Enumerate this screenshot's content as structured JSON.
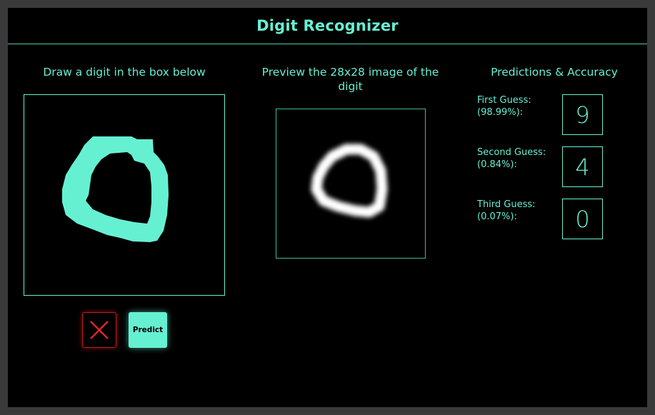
{
  "app": {
    "title": "Digit Recognizer"
  },
  "draw_panel": {
    "heading": "Draw a digit in the box below",
    "clear_button_icon": "close-icon",
    "predict_label": "Predict"
  },
  "preview_panel": {
    "heading": "Preview the 28x28 image of the digit"
  },
  "predictions_panel": {
    "heading": "Predictions & Accuracy",
    "guesses": [
      {
        "label": "First Guess:",
        "accuracy": "(98.99%):",
        "digit": "9"
      },
      {
        "label": "Second Guess:",
        "accuracy": "(0.84%):",
        "digit": "4"
      },
      {
        "label": "Third Guess:",
        "accuracy": "(0.07%):",
        "digit": "0"
      }
    ]
  },
  "colors": {
    "accent": "#66f0d2",
    "danger": "#c81d1d",
    "background": "#000000",
    "outer": "#3a3a3a"
  }
}
